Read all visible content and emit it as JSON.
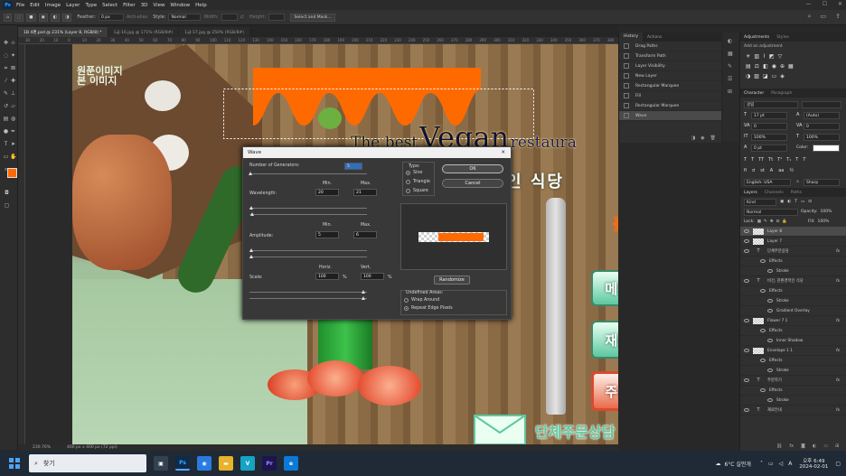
{
  "menu": {
    "logo": "Ps",
    "items": [
      "File",
      "Edit",
      "Image",
      "Layer",
      "Type",
      "Select",
      "Filter",
      "3D",
      "View",
      "Window",
      "Help"
    ]
  },
  "options": {
    "feather_label": "Feather:",
    "feather_value": "0 px",
    "antialias_label": "Anti-alias",
    "style_label": "Style:",
    "style_value": "Normal",
    "width_label": "Width:",
    "height_label": "Height:",
    "select_mask": "Select and Mask..."
  },
  "tabs": [
    "1B 4편.psd @ 231% (Layer 8, RGB/8) *",
    "1급-16.jpg @ 171% (RGB/8#)",
    "1급-17.jpg @ 250% (RGB/8#)"
  ],
  "ruler_ticks": [
    "30",
    "20",
    "10",
    "0",
    "10",
    "20",
    "30",
    "40",
    "50",
    "60",
    "70",
    "80",
    "90",
    "100",
    "110",
    "120",
    "130",
    "140",
    "150",
    "160",
    "170",
    "180",
    "190",
    "200",
    "210",
    "220",
    "230",
    "240",
    "250",
    "260",
    "270",
    "280",
    "290",
    "300",
    "310",
    "320",
    "330",
    "340",
    "350",
    "360",
    "370",
    "380"
  ],
  "status": {
    "zoom": "230.76%",
    "size": "400 px x 400 px (72 ppi)"
  },
  "history": {
    "tabs": [
      "History",
      "Actions"
    ],
    "items": [
      "Drag Paths",
      "Transform Path",
      "Layer Visibility",
      "New Layer",
      "Rectangular Marquee",
      "Fill",
      "Rectangular Marquee",
      "Wave"
    ],
    "selected": 7
  },
  "adjustments": {
    "tabs": [
      "Adjustments",
      "Styles"
    ],
    "add": "Add an adjustment"
  },
  "character": {
    "tabs": [
      "Character",
      "Paragraph"
    ],
    "font": "굴림",
    "size": "17 pt",
    "leading": "(Auto)",
    "kern": "0",
    "track": "0",
    "vscale": "100%",
    "hscale": "100%",
    "baseline": "0 pt",
    "color_label": "Color:",
    "lang": "English: USA",
    "aa": "Sharp",
    "aa_prefix": "a"
  },
  "layers": {
    "tabs": [
      "Layers",
      "Channels",
      "Paths"
    ],
    "kind": "Kind",
    "blend": "Normal",
    "opacity_label": "Opacity:",
    "opacity": "100%",
    "lock_label": "Lock:",
    "fill_label": "Fill:",
    "fill": "100%",
    "rows": [
      {
        "type": "thumb",
        "name": "Layer 8",
        "sel": true,
        "level": 0
      },
      {
        "type": "thumb",
        "name": "Layer 7",
        "level": 0
      },
      {
        "type": "text",
        "name": "단체주문상담",
        "fx": "fx",
        "level": 0
      },
      {
        "type": "fx",
        "name": "Effects",
        "level": 1
      },
      {
        "type": "fx",
        "name": "Stroke",
        "level": 2
      },
      {
        "type": "text",
        "name": "비건, 친환경적인 식당",
        "fx": "fx",
        "level": 0
      },
      {
        "type": "fx",
        "name": "Effects",
        "level": 1
      },
      {
        "type": "fx",
        "name": "Stroke",
        "level": 2
      },
      {
        "type": "fx",
        "name": "Gradient Overlay",
        "level": 2
      },
      {
        "type": "thumb",
        "name": "Flower 7 1",
        "fx": "fx",
        "level": 0
      },
      {
        "type": "fx",
        "name": "Effects",
        "level": 1
      },
      {
        "type": "fx",
        "name": "Inner Shadow",
        "level": 2
      },
      {
        "type": "thumb",
        "name": "Envelope 1 1",
        "fx": "fx",
        "level": 0
      },
      {
        "type": "fx",
        "name": "Effects",
        "level": 1
      },
      {
        "type": "fx",
        "name": "Stroke",
        "level": 2
      },
      {
        "type": "text",
        "name": "주문하기",
        "fx": "fx",
        "level": 0
      },
      {
        "type": "fx",
        "name": "Effects",
        "level": 1
      },
      {
        "type": "fx",
        "name": "Stroke",
        "level": 2
      },
      {
        "type": "text",
        "name": "재료안내",
        "fx": "fx",
        "level": 0
      }
    ]
  },
  "artwork": {
    "top_left_text": [
      "원푼이미지",
      "본 이미지"
    ],
    "headline_the_best": "The best",
    "headline_vegan": "Vegan",
    "headline_restaurant": "restaura",
    "korean_sub": "인 식당",
    "buttons": [
      "메뉴검색",
      "재료안내",
      "주문하기"
    ],
    "group_order": "단체주문상담",
    "wave_color": "#ff6a00",
    "mint": "#5ec8a0",
    "order_red": "#e04a3a"
  },
  "wave": {
    "title": "Wave",
    "gen_label": "Number of Generators:",
    "gen_value": "5",
    "type_label": "Type:",
    "types": [
      "Sine",
      "Triangle",
      "Square"
    ],
    "type_selected": 0,
    "ok": "OK",
    "cancel": "Cancel",
    "min_label": "Min.",
    "max_label": "Max.",
    "wavelength_label": "Wavelength:",
    "wl_min": "20",
    "wl_max": "21",
    "amp_label": "Amplitude:",
    "amp_min": "5",
    "amp_max": "6",
    "horiz_label": "Horiz.",
    "vert_label": "Vert.",
    "scale_label": "Scale:",
    "scale_h": "100",
    "scale_v": "100",
    "pct": "%",
    "randomize": "Randomize",
    "undef_label": "Undefined Areas:",
    "undef": [
      "Wrap Around",
      "Repeat Edge Pixels"
    ],
    "undef_selected": 1
  },
  "taskbar": {
    "search": "찾기",
    "weather": "6°C 실안개",
    "time": "오후 6:49",
    "date": "2024-02-01",
    "ime": "A"
  }
}
